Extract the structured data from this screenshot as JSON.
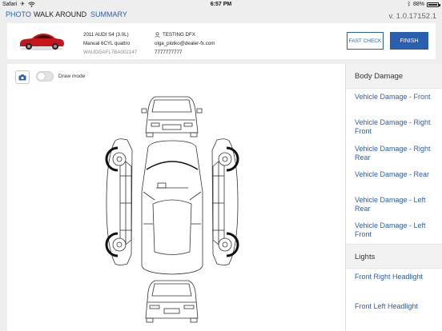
{
  "status_bar": {
    "carrier": "Safari",
    "time": "6:57 PM",
    "battery_text": "88%",
    "battery_level": 0.88
  },
  "tabs": [
    {
      "label": "PHOTO",
      "active": false
    },
    {
      "label": "WALK AROUND",
      "active": true
    },
    {
      "label": "SUMMARY",
      "active": false
    }
  ],
  "version": "v. 1.0.17152.1",
  "vehicle": {
    "title": "2011 AUDI S4 (3.0L)",
    "trim": "Manual 6CYL quattro",
    "vin": "WAUDGAFL7BA002147"
  },
  "customer": {
    "name": "TESTING DFX",
    "email": "olga_plotko@dealer-fx.com",
    "phone": "7777777777"
  },
  "actions": {
    "fast_check": "FAST CHECK",
    "finish": "FINISH"
  },
  "diagram": {
    "draw_mode_label": "Draw mode",
    "draw_mode_on": false
  },
  "sidebar": {
    "sections": [
      {
        "title": "Body Damage",
        "items": [
          "Vehicle Damage - Front",
          "Vehicle Damage - Right Front",
          "Vehicle Damage - Right Rear",
          "Vehicle Damage - Rear",
          "Vehicle Damage - Left Rear",
          "Vehicle Damage - Left Front"
        ]
      },
      {
        "title": "Lights",
        "items": [
          "Front Right Headlight",
          "Front Left Headlight"
        ]
      }
    ]
  },
  "colors": {
    "accent": "#2a5fb0",
    "car_red": "#c8151c"
  },
  "icons": [
    "camera-icon",
    "person-icon",
    "airplane-icon",
    "wifi-icon",
    "battery-icon"
  ]
}
